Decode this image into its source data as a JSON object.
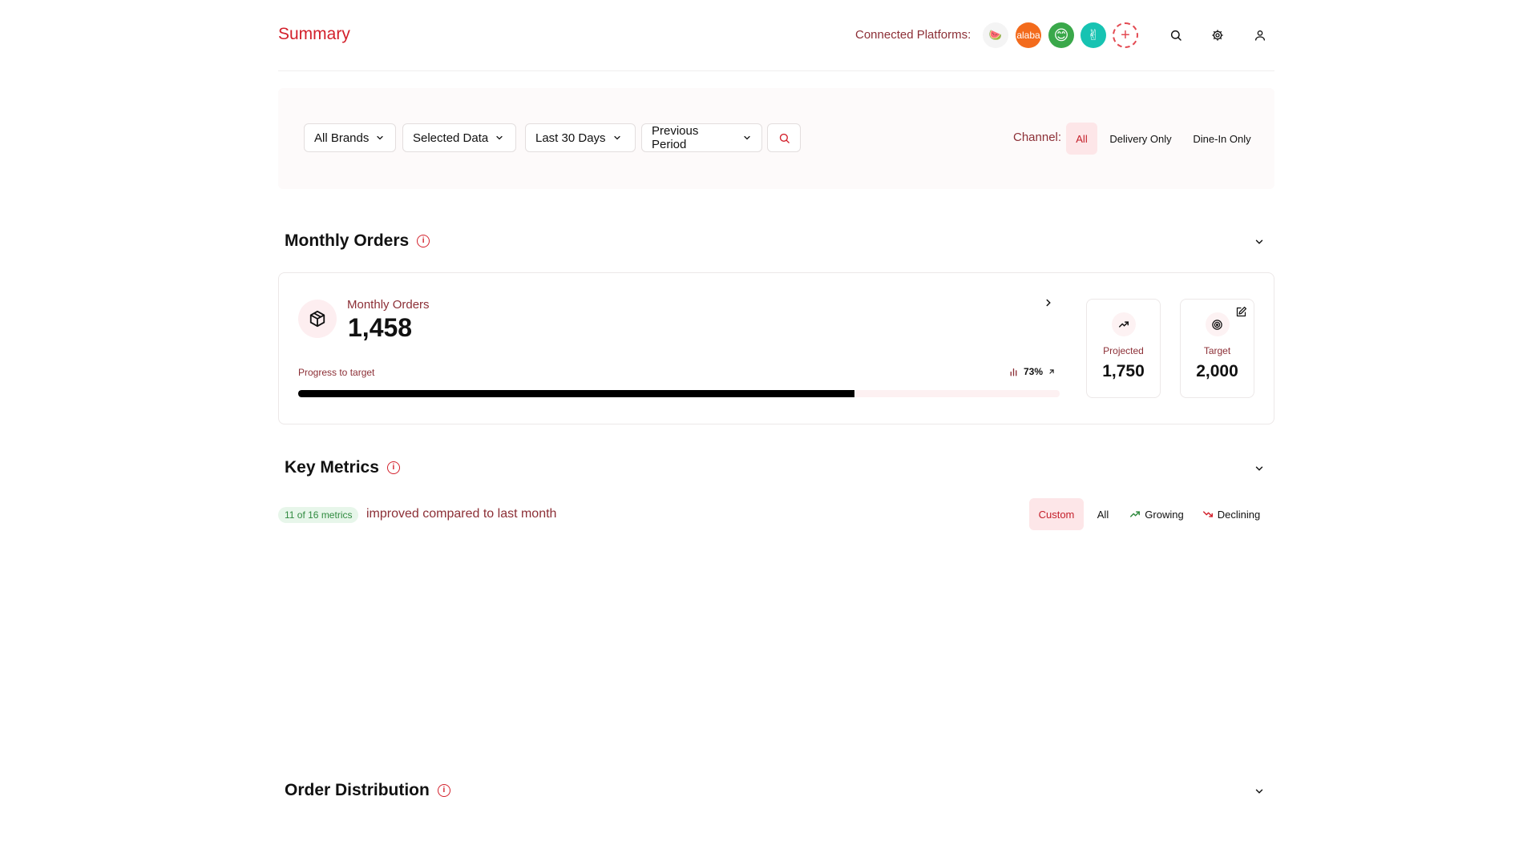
{
  "header": {
    "title": "Summary",
    "platforms_label": "Connected Platforms:",
    "platforms": [
      {
        "name": "platform-1",
        "glyph": "🍉"
      },
      {
        "name": "platform-2",
        "glyph": "alaba"
      },
      {
        "name": "platform-3",
        "glyph": "😊"
      },
      {
        "name": "platform-4",
        "glyph": "✌"
      }
    ],
    "add_glyph": "+"
  },
  "filters": {
    "dropdowns": [
      "All Brands",
      "Selected Data",
      "Last 30 Days",
      "Previous Period"
    ],
    "channel_label": "Channel:",
    "channels": [
      "All",
      "Delivery Only",
      "Dine-In Only"
    ],
    "active_channel": "All"
  },
  "monthly_orders": {
    "section_title": "Monthly Orders",
    "card_label": "Monthly Orders",
    "value": "1,458",
    "progress_label": "Progress to target",
    "progress_pct_text": "73%",
    "progress_fraction": 0.73,
    "projected_label": "Projected",
    "projected_value": "1,750",
    "target_label": "Target",
    "target_value": "2,000"
  },
  "key_metrics": {
    "section_title": "Key Metrics",
    "badge": "11 of 16 metrics",
    "improved_text": "improved compared to last month",
    "filters": [
      "Custom",
      "All",
      "Growing",
      "Declining"
    ],
    "active_filter": "Custom"
  },
  "order_distribution": {
    "section_title": "Order Distribution"
  },
  "colors": {
    "accent": "#d3212c",
    "muted_accent": "#8c2f36",
    "growing": "#2f8a3f",
    "declining": "#d3212c"
  }
}
